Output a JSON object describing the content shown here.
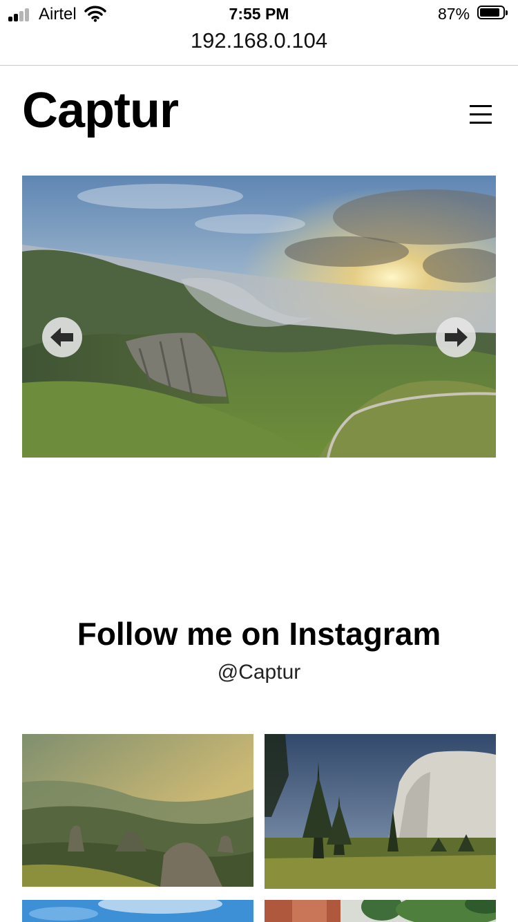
{
  "status_bar": {
    "carrier": "Airtel",
    "time": "7:55 PM",
    "battery_percent": "87%",
    "battery_level": 0.87,
    "signal_bars_filled": 2,
    "signal_bars_total": 4
  },
  "browser": {
    "address": "192.168.0.104"
  },
  "site": {
    "logo": "Captur",
    "menu_icon": "hamburger-menu-icon"
  },
  "hero": {
    "prev_icon": "arrow-left-icon",
    "next_icon": "arrow-right-icon"
  },
  "instagram": {
    "title": "Follow me on Instagram",
    "handle": "@Captur",
    "tiles": [
      {
        "subject": "misty-mountain-rocks-photo"
      },
      {
        "subject": "pine-trees-granite-cliff-photo"
      },
      {
        "subject": "blue-sky-photo"
      },
      {
        "subject": "red-rock-trees-photo"
      }
    ]
  },
  "colors": {
    "text": "#000000",
    "arrow_bg": "#e6e6e6",
    "arrow_glyph": "#2b2b2b",
    "divider": "#c8c8c8"
  }
}
